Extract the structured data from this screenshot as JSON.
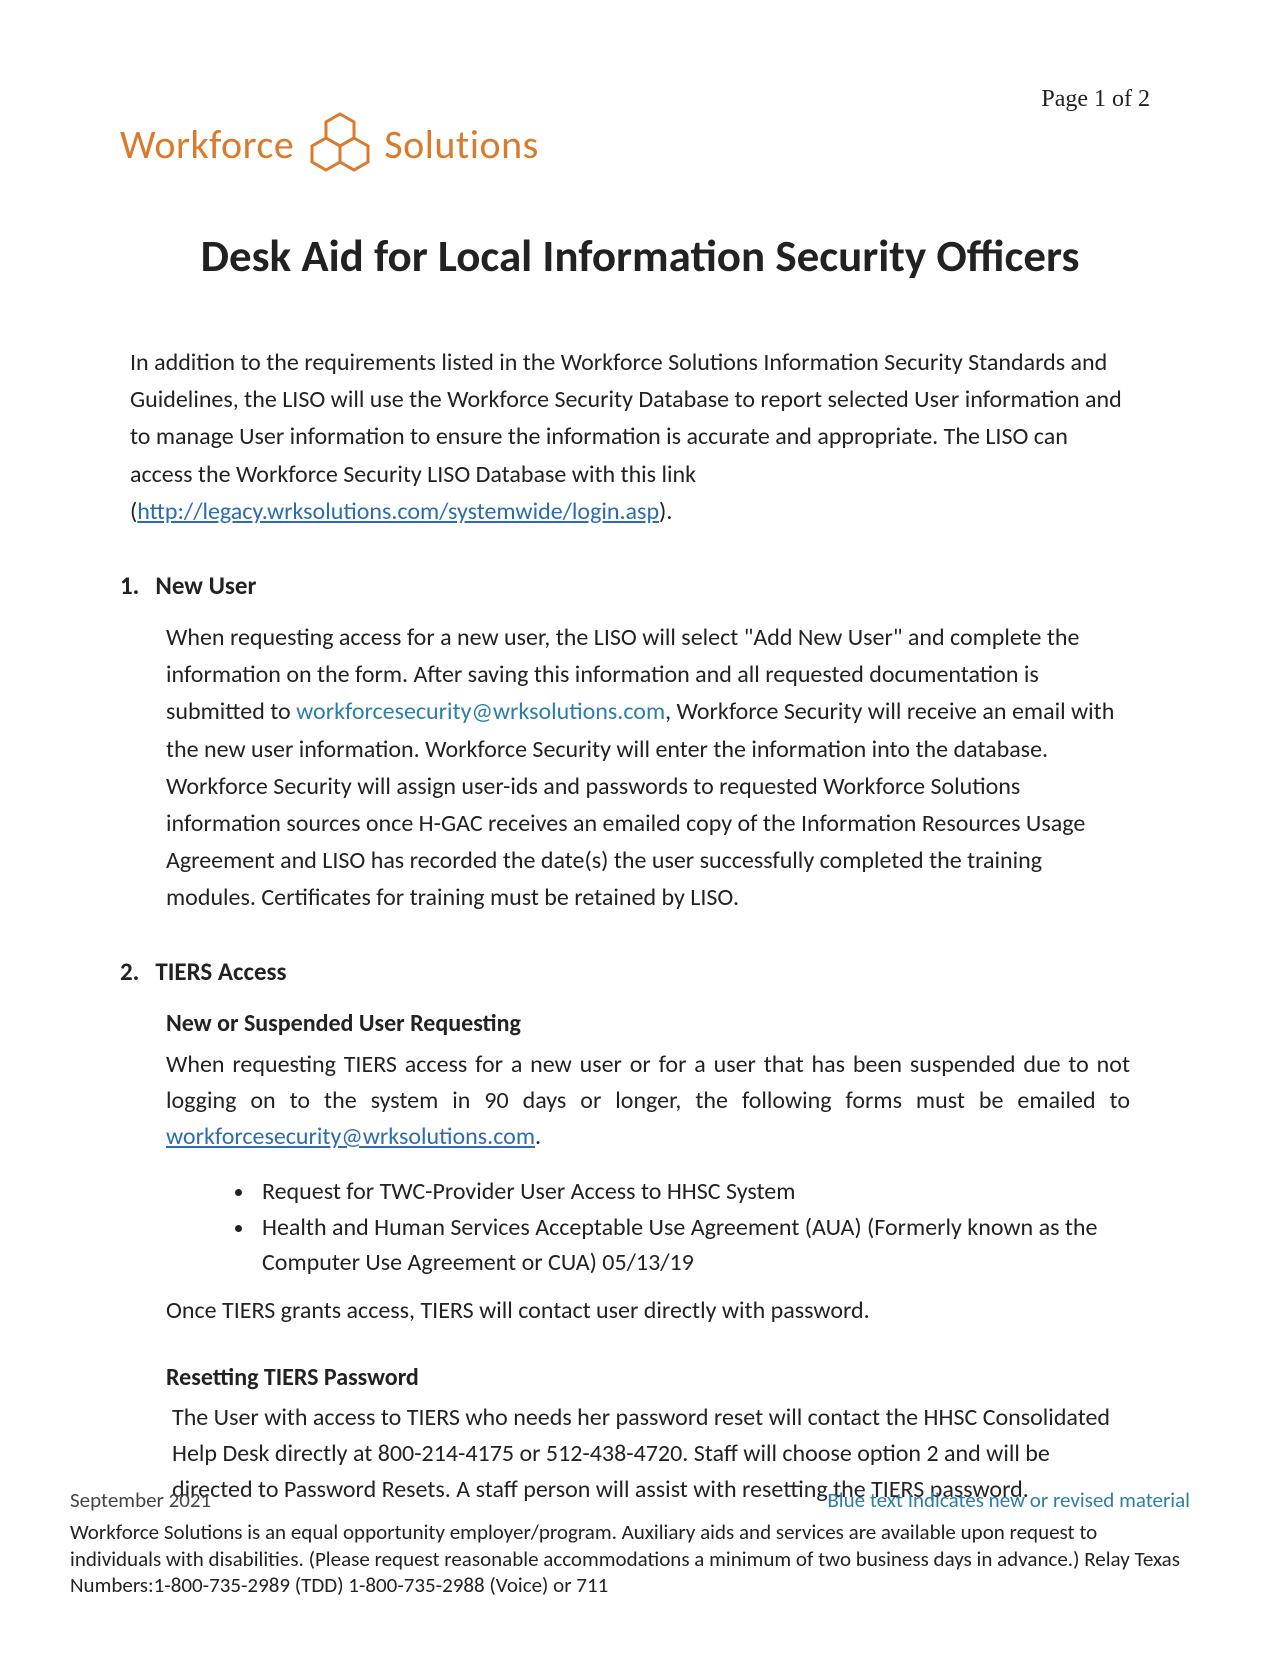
{
  "page_indicator": "Page 1 of 2",
  "logo": {
    "word1": "Workforce",
    "word2": "Solutions"
  },
  "title": "Desk Aid for Local Information Security Officers",
  "intro": {
    "text_before_link": "In addition to the requirements listed in the Workforce Solutions Information Security Standards and Guidelines, the LISO will use the Workforce Security Database to report selected User information and to manage User information to ensure the information is accurate and appropriate. The LISO can access the Workforce Security LISO Database with this link ",
    "paren_open": "(",
    "link_text": "http://legacy.wrksolutions.com/systemwide/login.asp",
    "paren_close": ").",
    "link_href": "http://legacy.wrksolutions.com/systemwide/login.asp"
  },
  "sections": {
    "s1": {
      "num": "1.",
      "title": "New User",
      "body_before_email": "When requesting access for a new user, the LISO will select \"Add New User\" and complete the information on the form.  After saving this information and all requested documentation is submitted to ",
      "email": "workforcesecurity@wrksolutions.com",
      "body_after_email": ",  Workforce Security will receive an email with the new user information. Workforce Security will enter the information into the database. Workforce Security will assign user-ids and passwords to requested Workforce Solutions information sources once H-GAC receives an emailed copy of the Information Resources Usage Agreement and LISO has recorded the date(s) the user successfully completed the training modules. Certificates for training must be retained by LISO."
    },
    "s2": {
      "num": "2.",
      "title": "TIERS Access",
      "sub1_title": "New or Suspended User Requesting",
      "sub1_body_before": "When requesting TIERS access for a new user or for a user that has been suspended due to not logging on to the system in 90 days or longer, the following forms must be emailed to ",
      "sub1_email": "workforcesecurity@wrksolutions.com",
      "sub1_body_after": ".",
      "bullets": [
        "Request for TWC-Provider User Access to HHSC System",
        "Health and Human Services Acceptable Use Agreement (AUA) (Formerly known as the Computer Use Agreement or CUA) 05/13/19"
      ],
      "sub1_closing": "Once TIERS grants access, TIERS will contact user directly with password.",
      "sub2_title": "Resetting TIERS Password",
      "sub2_body": "The User with access to TIERS who needs her password reset will contact the HHSC Consolidated Help Desk directly at 800-214-4175 or 512-438-4720.  Staff will choose option 2 and will be directed to Password Resets.   A staff person will assist with resetting the TIERS password."
    }
  },
  "footer": {
    "date": "September 2021",
    "note": "Blue text Indicates new or revised material",
    "legal": "Workforce Solutions is an equal opportunity employer/program. Auxiliary aids and services are available upon request to individuals with disabilities. (Please request reasonable accommodations a minimum of two business days in advance.) Relay Texas Numbers:1-800-735-2989 (TDD) 1-800-735-2988 (Voice) or 711"
  }
}
